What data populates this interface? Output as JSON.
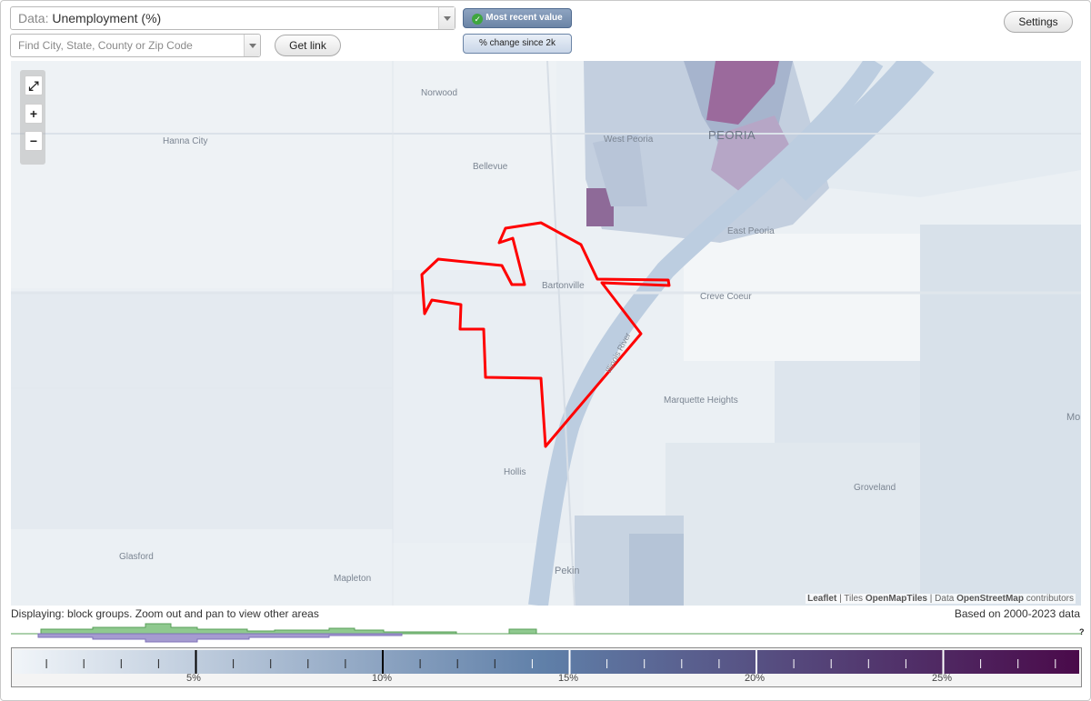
{
  "controls": {
    "data_prefix": "Data: ",
    "data_value": "Unemployment (%)",
    "search_placeholder": "Find City, State, County or Zip Code",
    "get_link": "Get link",
    "settings": "Settings",
    "toggle_active": "Most recent value",
    "toggle_inactive": "% change since 2k"
  },
  "map": {
    "places": {
      "norwood": "Norwood",
      "hanna_city": "Hanna City",
      "west_peoria": "West Peoria",
      "peoria": "PEORIA",
      "bellevue": "Bellevue",
      "east_peoria": "East Peoria",
      "bartonville": "Bartonville",
      "creve_coeur": "Creve Coeur",
      "marquette_heights": "Marquette Heights",
      "illinois_river": "Illinois River",
      "hollis": "Hollis",
      "groveland": "Groveland",
      "glasford": "Glasford",
      "mapleton": "Mapleton",
      "pekin": "Pekin",
      "mort": "Mort"
    },
    "highlight_color": "#ff0000",
    "zoom": {
      "fit": "⤢",
      "in": "+",
      "out": "−"
    },
    "attribution": {
      "leaflet": "Leaflet",
      "sep1": " | Tiles ",
      "tiles": "OpenMapTiles",
      "sep2": " | Data ",
      "data": "OpenStreetMap",
      "tail": " contributors"
    }
  },
  "status": {
    "displaying": "Displaying: block groups. Zoom out and pan to view other areas",
    "based_on": "Based on 2000-2023 data"
  },
  "legend": {
    "color_low": "#f1f5f9",
    "color_mid": "#5f7fa8",
    "color_high": "#4a0a4a",
    "ticks": [
      "5%",
      "10%",
      "15%",
      "20%",
      "25%"
    ],
    "unknown_mark": "?"
  }
}
